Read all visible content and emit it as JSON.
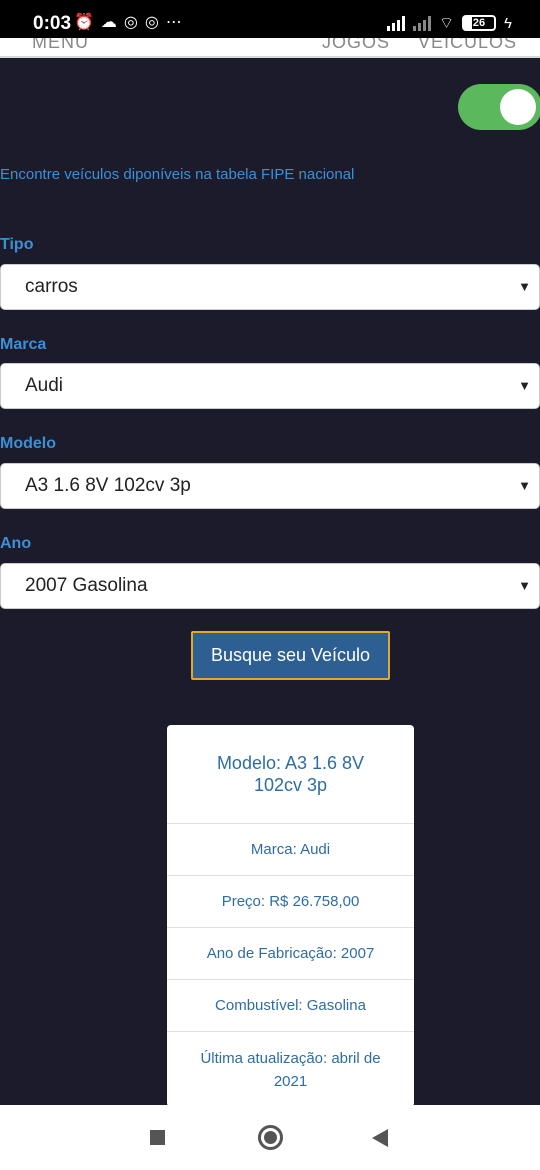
{
  "status_bar": {
    "time": "0:03",
    "battery": "26"
  },
  "topnav": {
    "menu": "MENU",
    "jogos": "JOGOS",
    "veiculos": "VEÍCULOS"
  },
  "toggle": {
    "on": true,
    "color": "#5cb85c"
  },
  "subtitle": "Encontre veículos diponíveis na tabela FIPE nacional",
  "form": {
    "tipo": {
      "label": "Tipo",
      "value": "carros"
    },
    "marca": {
      "label": "Marca",
      "value": "Audi"
    },
    "modelo": {
      "label": "Modelo",
      "value": "A3 1.6 8V 102cv 3p"
    },
    "ano": {
      "label": "Ano",
      "value": "2007 Gasolina"
    }
  },
  "search_button": "Busque seu Veículo",
  "result": {
    "modelo": "Modelo: A3 1.6 8V 102cv 3p",
    "marca": "Marca: Audi",
    "preco": "Preço: R$ 26.758,00",
    "ano_fabricacao": "Ano de Fabricação: 2007",
    "combustivel": "Combustível: Gasolina",
    "ultima_atualizacao": "Última atualização: abril de 2021"
  },
  "colors": {
    "background": "#1b1b2b",
    "accent_text": "#3d8fd6",
    "button": "#2e5f93",
    "button_border": "#e0a82e"
  }
}
